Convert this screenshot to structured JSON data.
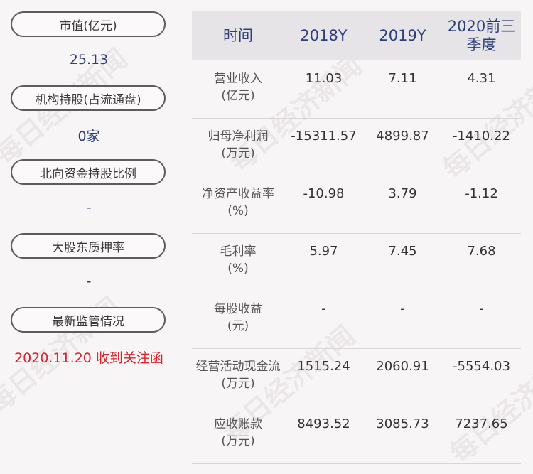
{
  "left": {
    "items": [
      {
        "label": "市值(亿元)",
        "value": "25.13"
      },
      {
        "label": "机构持股(占流通盘)",
        "value": "0家"
      },
      {
        "label": "北向资金持股比例",
        "value": "-"
      },
      {
        "label": "大股东质押率",
        "value": "-"
      },
      {
        "label": "最新监管情况",
        "value": "2020.11.20 收到关注函"
      }
    ]
  },
  "table": {
    "headers": [
      "时间",
      "2018Y",
      "2019Y",
      "2020前三季度"
    ],
    "rows": [
      {
        "label1": "营业收入",
        "label2": "(亿元)",
        "v": [
          "11.03",
          "7.11",
          "4.31"
        ]
      },
      {
        "label1": "归母净利润",
        "label2": "(万元)",
        "v": [
          "-15311.57",
          "4899.87",
          "-1410.22"
        ]
      },
      {
        "label1": "净资产收益率",
        "label2": "(%)",
        "v": [
          "-10.98",
          "3.79",
          "-1.12"
        ]
      },
      {
        "label1": "毛利率",
        "label2": "(%)",
        "v": [
          "5.97",
          "7.45",
          "7.68"
        ]
      },
      {
        "label1": "每股收益",
        "label2": "(元)",
        "v": [
          "-",
          "-",
          "-"
        ]
      },
      {
        "label1": "经营活动现金流",
        "label2": "(万元)",
        "v": [
          "1515.24",
          "2060.91",
          "-5554.03"
        ]
      },
      {
        "label1": "应收账款",
        "label2": "(万元)",
        "v": [
          "8493.52",
          "3085.73",
          "7237.65"
        ]
      }
    ]
  },
  "watermark": "每日经济新闻",
  "colors": {
    "accent": "#2c3f7a",
    "alert": "#d6242c",
    "header_bg": "#e6e4e6"
  }
}
